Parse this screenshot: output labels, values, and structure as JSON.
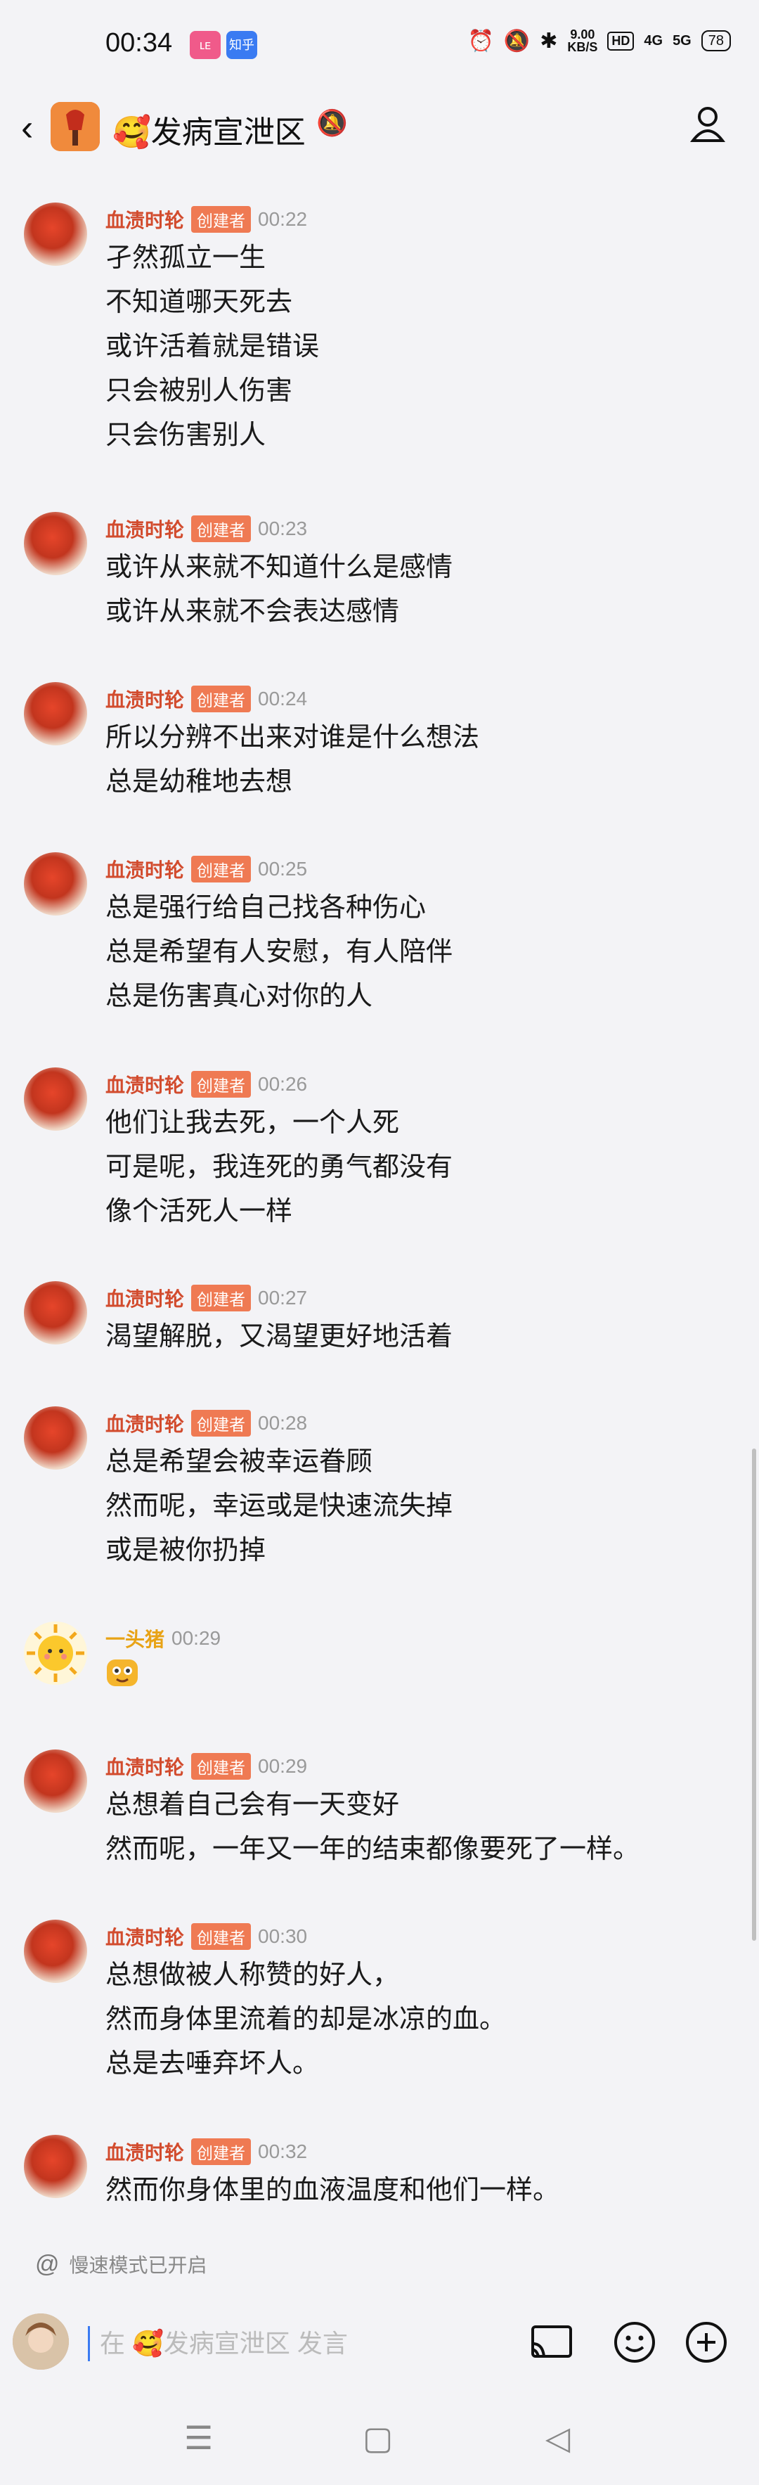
{
  "status_bar": {
    "time": "00:34",
    "app1": "ʟᴇ",
    "app2": "知乎",
    "speed_value": "9.00",
    "speed_unit": "KB/S",
    "hd": "HD",
    "net1": "4G",
    "net2": "5G",
    "battery": "78"
  },
  "header": {
    "title": "🥰发病宣泄区"
  },
  "messages": [
    {
      "name": "血渍时轮",
      "badge": "创建者",
      "time": "00:22",
      "lines": [
        "孑然孤立一生",
        "不知道哪天死去",
        "或许活着就是错误",
        "只会被别人伤害",
        "只会伤害别人"
      ]
    },
    {
      "name": "血渍时轮",
      "badge": "创建者",
      "time": "00:23",
      "lines": [
        "或许从来就不知道什么是感情",
        "或许从来就不会表达感情"
      ]
    },
    {
      "name": "血渍时轮",
      "badge": "创建者",
      "time": "00:24",
      "lines": [
        "所以分辨不出来对谁是什么想法",
        "总是幼稚地去想"
      ]
    },
    {
      "name": "血渍时轮",
      "badge": "创建者",
      "time": "00:25",
      "lines": [
        "总是强行给自己找各种伤心",
        "总是希望有人安慰，有人陪伴",
        "总是伤害真心对你的人"
      ]
    },
    {
      "name": "血渍时轮",
      "badge": "创建者",
      "time": "00:26",
      "lines": [
        "他们让我去死，一个人死",
        "可是呢，我连死的勇气都没有",
        "像个活死人一样"
      ]
    },
    {
      "name": "血渍时轮",
      "badge": "创建者",
      "time": "00:27",
      "lines": [
        "渴望解脱，又渴望更好地活着"
      ]
    },
    {
      "name": "血渍时轮",
      "badge": "创建者",
      "time": "00:28",
      "lines": [
        "总是希望会被幸运眷顾",
        "然而呢，幸运或是快速流失掉",
        "或是被你扔掉"
      ]
    },
    {
      "name": "一头猪",
      "badge": "",
      "time": "00:29",
      "lines": []
    },
    {
      "name": "血渍时轮",
      "badge": "创建者",
      "time": "00:29",
      "lines": [
        "总想着自己会有一天变好",
        "然而呢，一年又一年的结束都像要死了一样。"
      ]
    },
    {
      "name": "血渍时轮",
      "badge": "创建者",
      "time": "00:30",
      "lines": [
        "总想做被人称赞的好人，",
        "然而身体里流着的却是冰凉的血。",
        "总是去唾弃坏人。"
      ]
    },
    {
      "name": "血渍时轮",
      "badge": "创建者",
      "time": "00:32",
      "lines": [
        "然而你身体里的血液温度和他们一样。"
      ]
    }
  ],
  "slow_mode": "慢速模式已开启",
  "input": {
    "placeholder": "在 🥰发病宣泄区 发言"
  }
}
